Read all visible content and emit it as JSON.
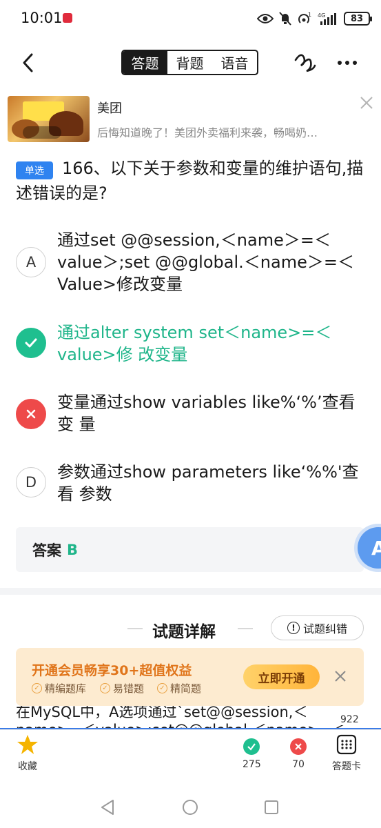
{
  "status_bar": {
    "time": "10:01",
    "battery": "83",
    "network": "4G"
  },
  "nav": {
    "tabs": [
      {
        "label": "答题",
        "active": true
      },
      {
        "label": "背题",
        "active": false
      },
      {
        "label": "语音",
        "active": false
      }
    ]
  },
  "ad": {
    "brand": "美团",
    "description": "后悔知道晚了！美团外卖福利来袭，畅喝奶…"
  },
  "question": {
    "tag": "单选",
    "text": "166、以下关于参数和变量的维护语句,描 述错误的是?"
  },
  "options": [
    {
      "letter": "A",
      "text": "通过set @@session,＜name＞=＜value＞;set @@global.＜name＞=＜Value>修改变量",
      "state": "plain"
    },
    {
      "letter": "B",
      "text": "通过alter system set＜name>=＜value>修 改变量",
      "state": "correct"
    },
    {
      "letter": "C",
      "text": "变量通过show variables like%‘%’查看变 量",
      "state": "wrong"
    },
    {
      "letter": "D",
      "text": "参数通过show parameters like‘%%'查看 参数",
      "state": "plain"
    }
  ],
  "answer": {
    "label": "答案",
    "value": "B"
  },
  "floating_button": {
    "label": "A"
  },
  "detail": {
    "title": "试题详解",
    "report_label": "试题纠错",
    "vip_title": "开通会员畅享30+超值权益",
    "vip_features": [
      "精编题库",
      "易错题",
      "精简题"
    ],
    "vip_button": "立即开通",
    "explain_line1": "在MySQL中，A选项通过`set@@session,＜",
    "explain_line2": "name>=＜value>;set@@global.＜name>=＜",
    "page_number": "922"
  },
  "bottom_bar": {
    "favorite_label": "收藏",
    "correct_count": "275",
    "wrong_count": "70",
    "card_label": "答题卡"
  },
  "colors": {
    "correct": "#1fbf8f",
    "wrong": "#ee4a4a",
    "tag_blue": "#2f83f0",
    "vip_orange": "#e0751b",
    "star": "#f5b400"
  }
}
